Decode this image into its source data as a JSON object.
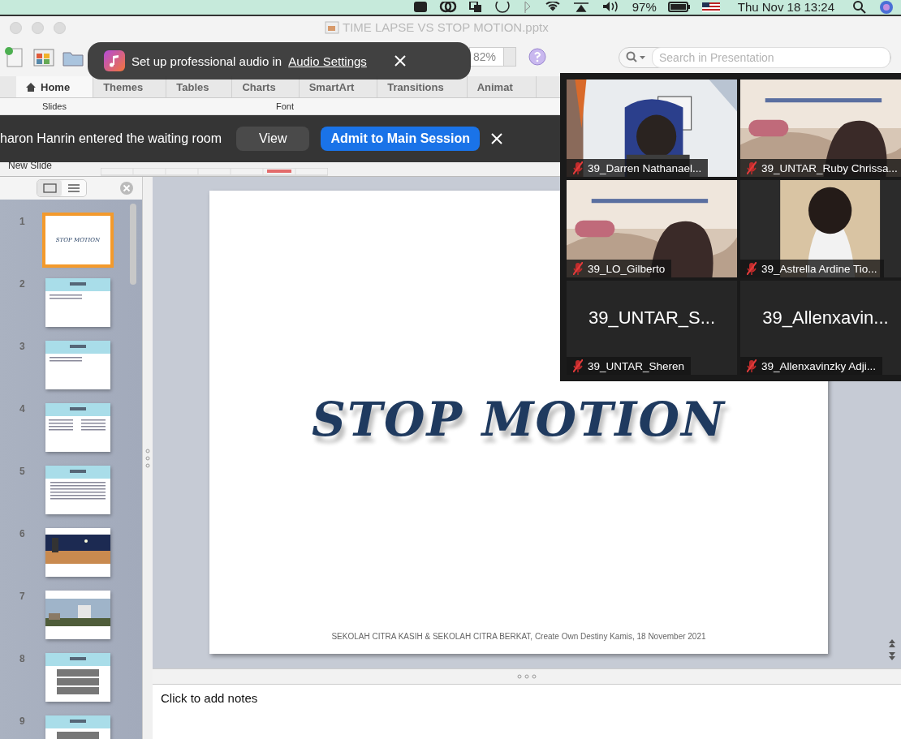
{
  "menu_bar": {
    "battery": "97%",
    "clock": "Thu Nov 18  13:24"
  },
  "window": {
    "title": "TIME LAPSE VS STOP MOTION.pptx"
  },
  "toolbar": {
    "zoom": "82%",
    "search": {
      "placeholder": "Search in Presentation"
    }
  },
  "ribbon": {
    "tabs": [
      {
        "label": "Home",
        "selected": true
      },
      {
        "label": "Themes",
        "selected": false
      },
      {
        "label": "Tables",
        "selected": false
      },
      {
        "label": "Charts",
        "selected": false
      },
      {
        "label": "SmartArt",
        "selected": false
      },
      {
        "label": "Transitions",
        "selected": false
      },
      {
        "label": "Animat",
        "selected": false
      }
    ],
    "groups": [
      "Slides",
      "Font"
    ],
    "new_slide": "New Slide"
  },
  "slide_panel": {
    "thumbnails": [
      {
        "number": "1",
        "selected": true,
        "kind": "title",
        "title": "STOP MOTION"
      },
      {
        "number": "2",
        "selected": false,
        "kind": "bullets"
      },
      {
        "number": "3",
        "selected": false,
        "kind": "bullets"
      },
      {
        "number": "4",
        "selected": false,
        "kind": "columns"
      },
      {
        "number": "5",
        "selected": false,
        "kind": "paragraph"
      },
      {
        "number": "6",
        "selected": false,
        "kind": "night"
      },
      {
        "number": "7",
        "selected": false,
        "kind": "city"
      },
      {
        "number": "8",
        "selected": false,
        "kind": "grid"
      },
      {
        "number": "9",
        "selected": false,
        "kind": "grid"
      }
    ]
  },
  "slide": {
    "title": "STOP MOTION",
    "footer": "SEKOLAH CITRA KASIH & SEKOLAH CITRA BERKAT, Create Own Destiny Kamis, 18 November 2021"
  },
  "notes": {
    "placeholder": "Click to add notes"
  },
  "audio_toast": {
    "text": "Set up professional audio in",
    "link": "Audio Settings"
  },
  "waiting_banner": {
    "message": "haron Hanrin entered the waiting room",
    "buttons": [
      {
        "label": "View",
        "kind": "secondary"
      },
      {
        "label": "Admit to Main Session",
        "kind": "primary"
      }
    ]
  },
  "video_grid": {
    "tiles": [
      {
        "name": "39_Darren Nathanael...",
        "muted": true,
        "kind": "picture"
      },
      {
        "name": "39_UNTAR_Ruby Chrissa...",
        "muted": true,
        "kind": "picture"
      },
      {
        "name": "39_LO_Gilberto",
        "muted": true,
        "kind": "picture"
      },
      {
        "name": "39_Astrella Ardine Tio...",
        "muted": true,
        "kind": "picture"
      },
      {
        "display": "39_UNTAR_S...",
        "name": "39_UNTAR_Sheren",
        "muted": true
      },
      {
        "display": "39_Allenxavin...",
        "name": "39_Allenxavinzky Adji...",
        "muted": true
      }
    ]
  }
}
